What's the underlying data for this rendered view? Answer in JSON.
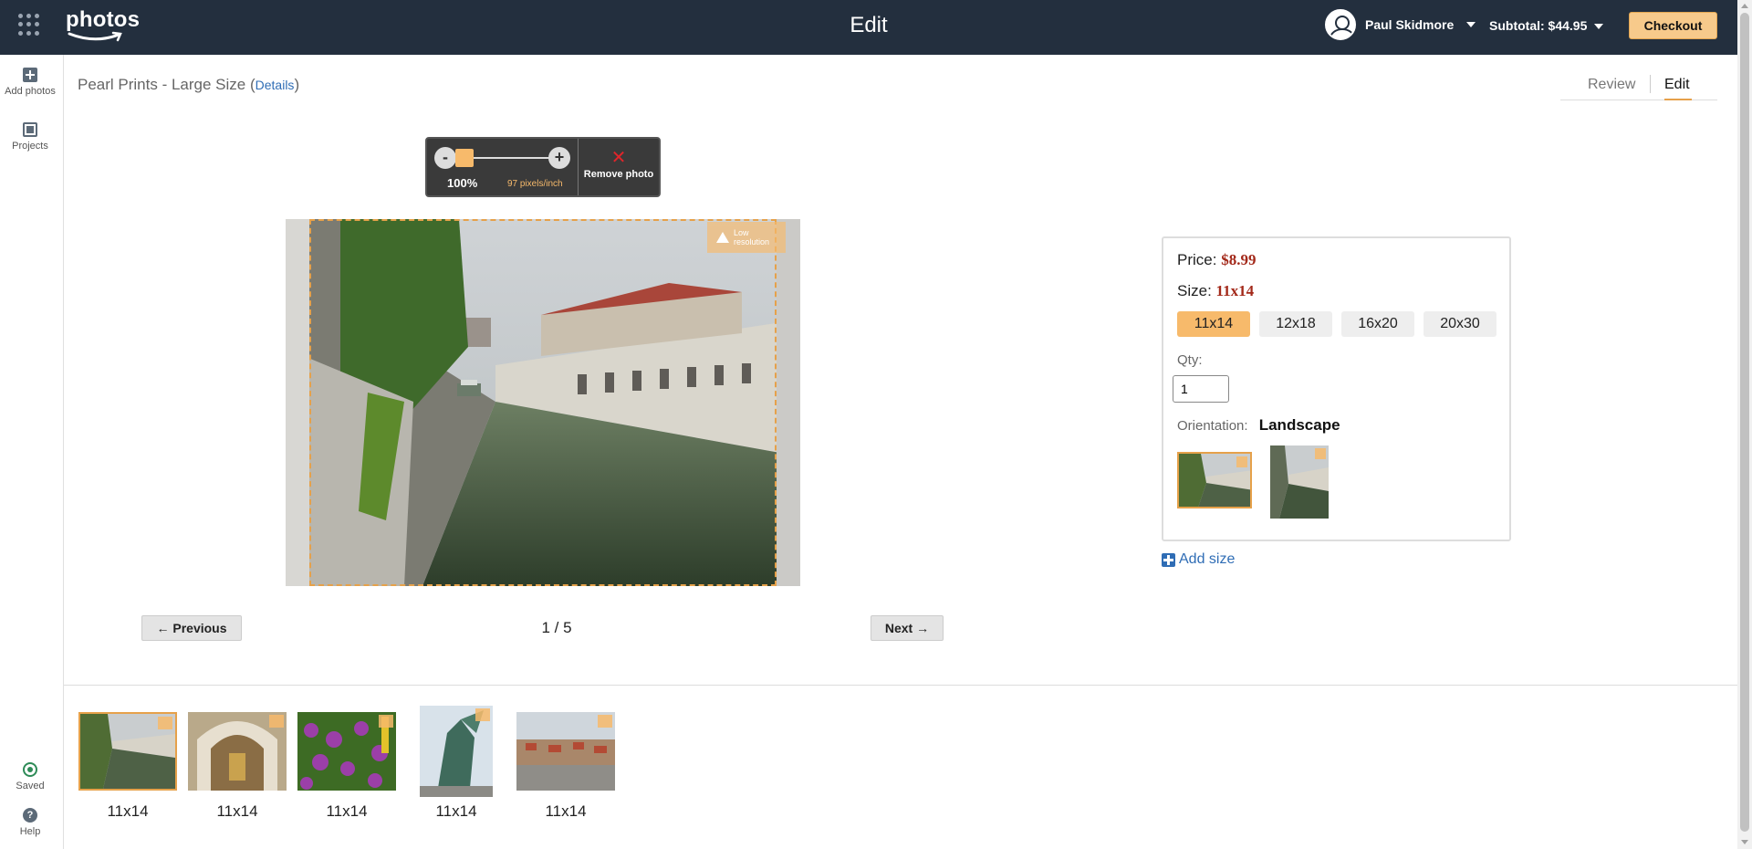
{
  "header": {
    "logo_text": "photos",
    "page_title": "Edit",
    "user_name": "Paul Skidmore",
    "subtotal": "Subtotal: $44.95",
    "checkout_label": "Checkout"
  },
  "sidebar": {
    "add_photos": "Add photos",
    "projects": "Projects",
    "saved": "Saved",
    "help": "Help"
  },
  "project": {
    "title": "Pearl Prints - Large Size",
    "details_link": "Details",
    "tabs": [
      "Review",
      "Edit"
    ],
    "active_tab": "Edit"
  },
  "editor": {
    "zoom_minus": "-",
    "zoom_plus": "+",
    "zoom_level": "100%",
    "zoom_slider_fraction": 0.1,
    "resolution": "97 pixels/inch",
    "remove_label": "Remove photo",
    "low_res_badge": "Low resolution"
  },
  "pager": {
    "previous": "← Previous",
    "next": "Next →",
    "position": "1 / 5"
  },
  "options": {
    "price_label": "Price:",
    "price": "$8.99",
    "size_label": "Size:",
    "size": "11x14",
    "sizes": [
      "11x14",
      "12x18",
      "16x20",
      "20x30"
    ],
    "selected_size": "11x14",
    "qty_label": "Qty:",
    "qty": "1",
    "orientation_label": "Orientation:",
    "orientation": "Landscape",
    "add_size": "Add size"
  },
  "filmstrip": {
    "items": [
      {
        "label": "11x14",
        "selected": true
      },
      {
        "label": "11x14",
        "selected": false
      },
      {
        "label": "11x14",
        "selected": false
      },
      {
        "label": "11x14",
        "selected": false
      },
      {
        "label": "11x14",
        "selected": false
      }
    ]
  },
  "colors": {
    "topbar": "#232f3e",
    "accent": "#f7ba6b",
    "price": "#a3291a",
    "link": "#2f6db5"
  }
}
